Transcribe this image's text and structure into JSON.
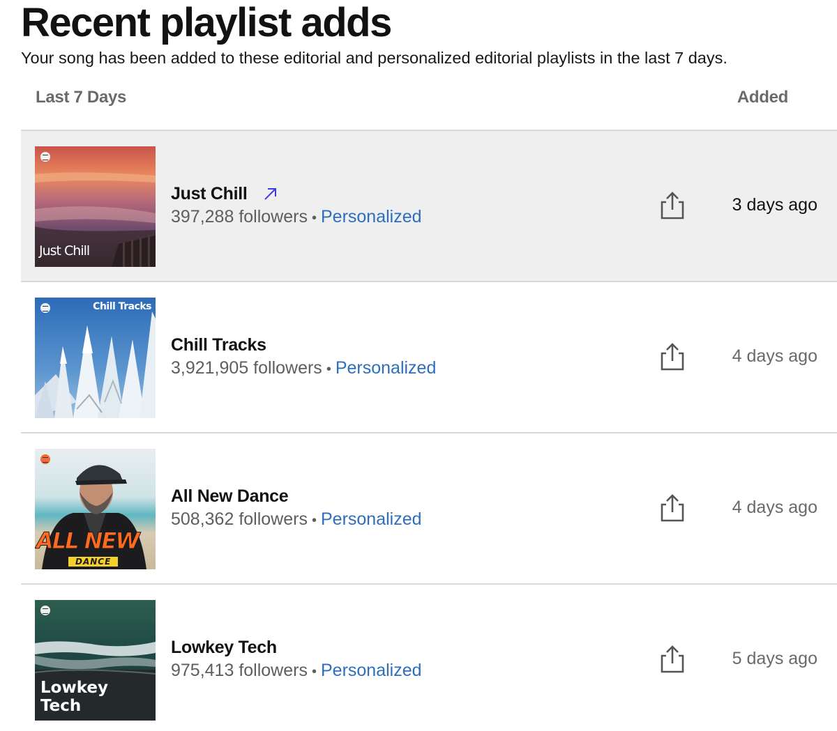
{
  "header": {
    "title": "Recent playlist adds",
    "subtitle": "Your song has been added to these editorial and personalized editorial playlists in the last 7 days."
  },
  "table": {
    "period_label": "Last 7 Days",
    "added_label": "Added"
  },
  "playlists": [
    {
      "name": "Just Chill",
      "followers": "397,288 followers",
      "tag": "Personalized",
      "added": "3 days ago",
      "cover_text": "Just Chill",
      "cover_icon": "sunset-ocean-image",
      "highlighted": true
    },
    {
      "name": "Chill Tracks",
      "followers": "3,921,905 followers",
      "tag": "Personalized",
      "added": "4 days ago",
      "cover_text": "Chill Tracks",
      "cover_icon": "snowy-trees-image"
    },
    {
      "name": "All New Dance",
      "followers": "508,362 followers",
      "tag": "Personalized",
      "added": "4 days ago",
      "cover_text": "ALL NEW",
      "cover_subtext": "DANCE",
      "cover_icon": "artist-portrait-image"
    },
    {
      "name": "Lowkey Tech",
      "followers": "975,413 followers",
      "tag": "Personalized",
      "added": "5 days ago",
      "cover_text": "Lowkey",
      "cover_subtext": "Tech",
      "cover_icon": "aerial-wave-image"
    }
  ],
  "colors": {
    "accent_link": "#2d6fbd",
    "highlight_row": "#efefef",
    "external_arrow": "#3d3be0"
  }
}
